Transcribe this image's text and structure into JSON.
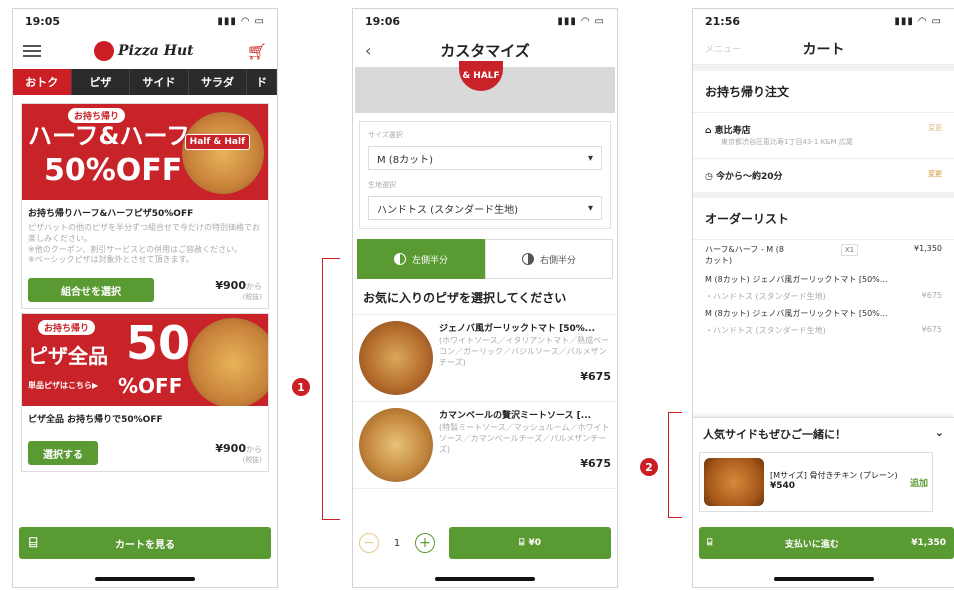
{
  "phone1": {
    "status_time": "19:05",
    "logo_text": "Pizza Hut",
    "tabs": [
      "おトク",
      "ピザ",
      "サイド",
      "サラダ",
      "ド"
    ],
    "promo1": {
      "banner_tag": "お持ち帰り",
      "banner_main": "ハーフ&ハーフ",
      "banner_off": "50%OFF",
      "banner_badge": "Half & Half",
      "title": "お持ち帰りハーフ&ハーフピザ50%OFF",
      "desc": "ピザハットの他のピザを半分ずつ組合せで今だけの特別価格でお楽しみください。\n※他のクーポン、割引サービスとの併用はご容赦ください。\n※ベーシックピザは対象外とさせて頂きます。",
      "button": "組合せを選択",
      "price": "¥900",
      "price_suffix": "から",
      "tax": "(税抜)"
    },
    "promo2": {
      "banner_tag": "お持ち帰り",
      "banner_main": "ピザ全品",
      "banner_50": "50",
      "banner_sub": "単品ピザはこちら▶",
      "banner_off": "%OFF",
      "title": "ピザ全品 お持ち帰りで50%OFF",
      "button": "選択する",
      "price": "¥900",
      "price_suffix": "から",
      "tax": "(税抜)"
    },
    "bottom_button": "カートを見る",
    "icons": {
      "menu": "hamburger-icon",
      "cart": "cart-icon"
    }
  },
  "phone2": {
    "status_time": "19:06",
    "title": "カスタマイズ",
    "badge": "& HALF",
    "size_label": "サイズ選択",
    "size_value": "M (8カット)",
    "crust_label": "生地選択",
    "crust_value": "ハンドトス (スタンダード生地)",
    "toggle_left": "左側半分",
    "toggle_right": "右側半分",
    "section_title": "お気に入りのピザを選択してください",
    "pizzas": [
      {
        "name": "ジェノバ風ガーリックトマト [50%...",
        "desc": "(ホワイトソース／イタリアントマト／熟成ベーコン／ガーリック／バジルソース／パルメザンチーズ)",
        "price": "¥675"
      },
      {
        "name": "カマンベールの贅沢ミートソース [...",
        "desc": "(特製ミートソース／マッシュルーム／ホワイトソース／カマンベールチーズ／パルメザンチーズ)",
        "price": "¥675"
      }
    ],
    "qty": "1",
    "add_button": "¥0"
  },
  "phone3": {
    "status_time": "21:56",
    "menu_link": "メニュー",
    "title": "カート",
    "order_type": "お持ち帰り注文",
    "store_name": "恵比寿店",
    "store_address": "東京都渋谷区恵比寿1丁目43-1 K&M 広尾",
    "edit": "変更",
    "time": "今から～約20分",
    "order_list_title": "オーダーリスト",
    "items": [
      {
        "name": "ハーフ&ハーフ - M (8カット)",
        "qty": "X1",
        "price": "¥1,350"
      }
    ],
    "lines": [
      {
        "name": "M (8カット) ジェノバ風ガーリックトマト [50%...",
        "sub": "・ハンドトス (スタンダード生地)",
        "price": "¥675"
      },
      {
        "name": "M (8カット) ジェノバ風ガーリックトマト [50%...",
        "sub": "・ハンドトス (スタンダード生地)",
        "price": "¥675"
      }
    ],
    "side_title": "人気サイドもぜひご一緒に！",
    "side_item": {
      "name": "[Mサイズ] 骨付きチキン (プレーン)",
      "price": "¥540",
      "add": "追加"
    },
    "pay_button": "支払いに進む",
    "pay_total": "¥1,350"
  },
  "annotations": [
    "1",
    "2"
  ],
  "accent_color": "#cc1f25",
  "green_color": "#5a9a32"
}
